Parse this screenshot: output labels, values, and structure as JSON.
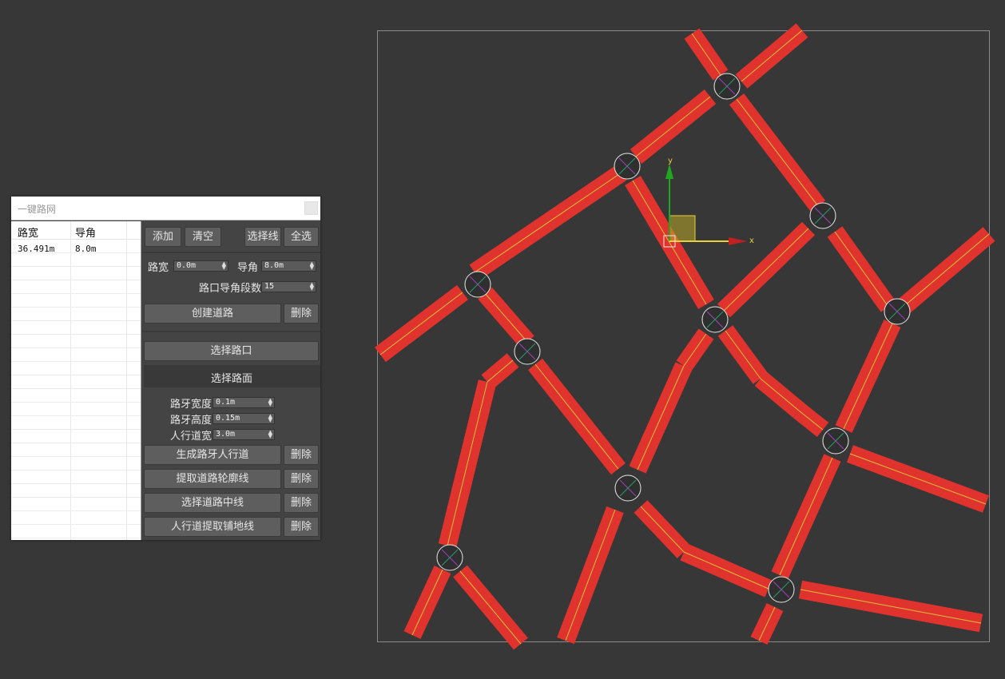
{
  "dialog": {
    "title": "一键路网",
    "list": {
      "headers": [
        "路宽",
        "导角"
      ],
      "rows": [
        [
          "36.491m",
          "8.0m"
        ]
      ]
    },
    "buttons": {
      "add": "添加",
      "clear": "清空",
      "select_line": "选择线",
      "select_all": "全选",
      "create_road": "创建道路",
      "delete": "删除",
      "select_intersection": "选择路口",
      "select_surface": "选择路面",
      "gen_curb": "生成路牙人行道",
      "extract_outline": "提取道路轮廓线",
      "select_centerline": "选择道路中线",
      "sidewalk_paving": "人行道提取铺地线"
    },
    "fields": {
      "road_width": {
        "label": "路宽",
        "value": "0.0m"
      },
      "chamfer": {
        "label": "导角",
        "value": "8.0m"
      },
      "chamfer_segments": {
        "label": "路口导角段数",
        "value": "15"
      },
      "curb_width": {
        "label": "路牙宽度",
        "value": "0.1m"
      },
      "curb_height": {
        "label": "路牙高度",
        "value": "0.15m"
      },
      "sidewalk_width": {
        "label": "人行道宽",
        "value": "3.0m"
      }
    }
  },
  "viewport": {
    "gizmo": {
      "x_label": "x",
      "y_label": "y"
    },
    "colors": {
      "road": "#e0332d",
      "centerline": "#d8c23a",
      "background": "#373737"
    }
  }
}
